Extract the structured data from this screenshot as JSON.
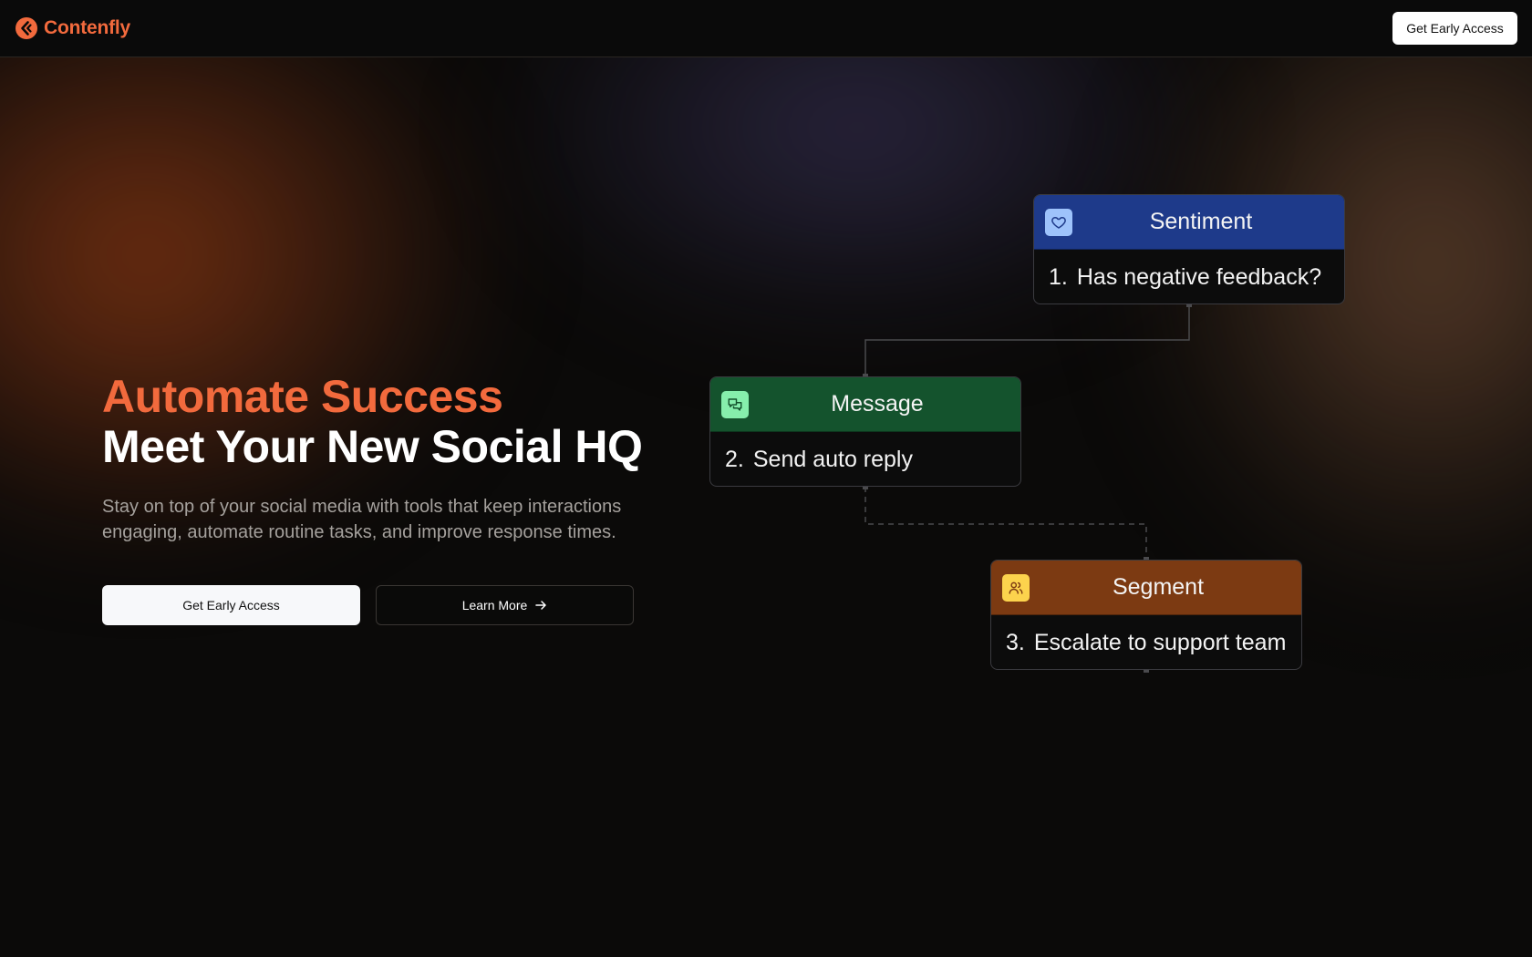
{
  "nav": {
    "brand": "Contenfly",
    "cta_label": "Get Early Access"
  },
  "hero": {
    "title_highlight": "Automate Success",
    "title_main": "Meet Your New Social HQ",
    "subtitle": "Stay on top of your social media with tools that keep interactions engaging, automate routine tasks, and improve response times.",
    "primary_label": "Get Early Access",
    "secondary_label": "Learn More"
  },
  "flow": {
    "nodes": [
      {
        "title": "Sentiment",
        "number": "1.",
        "step": "Has negative feedback?",
        "icon": "heart-icon",
        "header_color": "#1e3a8a"
      },
      {
        "title": "Message",
        "number": "2.",
        "step": "Send auto reply",
        "icon": "chat-bubbles-icon",
        "header_color": "#14532d"
      },
      {
        "title": "Segment",
        "number": "3.",
        "step": "Escalate to support team",
        "icon": "users-icon",
        "header_color": "#7c3a12"
      }
    ]
  },
  "colors": {
    "accent": "#f26a3d",
    "background": "#0b0a09"
  }
}
